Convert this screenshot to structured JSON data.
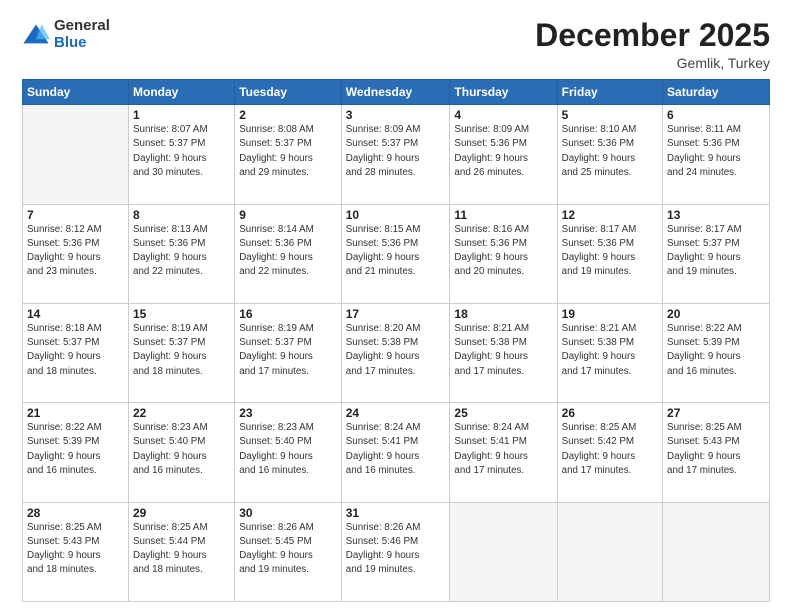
{
  "logo": {
    "general": "General",
    "blue": "Blue"
  },
  "title": "December 2025",
  "subtitle": "Gemlik, Turkey",
  "days_header": [
    "Sunday",
    "Monday",
    "Tuesday",
    "Wednesday",
    "Thursday",
    "Friday",
    "Saturday"
  ],
  "weeks": [
    [
      {
        "day": "",
        "info": ""
      },
      {
        "day": "1",
        "info": "Sunrise: 8:07 AM\nSunset: 5:37 PM\nDaylight: 9 hours\nand 30 minutes."
      },
      {
        "day": "2",
        "info": "Sunrise: 8:08 AM\nSunset: 5:37 PM\nDaylight: 9 hours\nand 29 minutes."
      },
      {
        "day": "3",
        "info": "Sunrise: 8:09 AM\nSunset: 5:37 PM\nDaylight: 9 hours\nand 28 minutes."
      },
      {
        "day": "4",
        "info": "Sunrise: 8:09 AM\nSunset: 5:36 PM\nDaylight: 9 hours\nand 26 minutes."
      },
      {
        "day": "5",
        "info": "Sunrise: 8:10 AM\nSunset: 5:36 PM\nDaylight: 9 hours\nand 25 minutes."
      },
      {
        "day": "6",
        "info": "Sunrise: 8:11 AM\nSunset: 5:36 PM\nDaylight: 9 hours\nand 24 minutes."
      }
    ],
    [
      {
        "day": "7",
        "info": "Sunrise: 8:12 AM\nSunset: 5:36 PM\nDaylight: 9 hours\nand 23 minutes."
      },
      {
        "day": "8",
        "info": "Sunrise: 8:13 AM\nSunset: 5:36 PM\nDaylight: 9 hours\nand 22 minutes."
      },
      {
        "day": "9",
        "info": "Sunrise: 8:14 AM\nSunset: 5:36 PM\nDaylight: 9 hours\nand 22 minutes."
      },
      {
        "day": "10",
        "info": "Sunrise: 8:15 AM\nSunset: 5:36 PM\nDaylight: 9 hours\nand 21 minutes."
      },
      {
        "day": "11",
        "info": "Sunrise: 8:16 AM\nSunset: 5:36 PM\nDaylight: 9 hours\nand 20 minutes."
      },
      {
        "day": "12",
        "info": "Sunrise: 8:17 AM\nSunset: 5:36 PM\nDaylight: 9 hours\nand 19 minutes."
      },
      {
        "day": "13",
        "info": "Sunrise: 8:17 AM\nSunset: 5:37 PM\nDaylight: 9 hours\nand 19 minutes."
      }
    ],
    [
      {
        "day": "14",
        "info": "Sunrise: 8:18 AM\nSunset: 5:37 PM\nDaylight: 9 hours\nand 18 minutes."
      },
      {
        "day": "15",
        "info": "Sunrise: 8:19 AM\nSunset: 5:37 PM\nDaylight: 9 hours\nand 18 minutes."
      },
      {
        "day": "16",
        "info": "Sunrise: 8:19 AM\nSunset: 5:37 PM\nDaylight: 9 hours\nand 17 minutes."
      },
      {
        "day": "17",
        "info": "Sunrise: 8:20 AM\nSunset: 5:38 PM\nDaylight: 9 hours\nand 17 minutes."
      },
      {
        "day": "18",
        "info": "Sunrise: 8:21 AM\nSunset: 5:38 PM\nDaylight: 9 hours\nand 17 minutes."
      },
      {
        "day": "19",
        "info": "Sunrise: 8:21 AM\nSunset: 5:38 PM\nDaylight: 9 hours\nand 17 minutes."
      },
      {
        "day": "20",
        "info": "Sunrise: 8:22 AM\nSunset: 5:39 PM\nDaylight: 9 hours\nand 16 minutes."
      }
    ],
    [
      {
        "day": "21",
        "info": "Sunrise: 8:22 AM\nSunset: 5:39 PM\nDaylight: 9 hours\nand 16 minutes."
      },
      {
        "day": "22",
        "info": "Sunrise: 8:23 AM\nSunset: 5:40 PM\nDaylight: 9 hours\nand 16 minutes."
      },
      {
        "day": "23",
        "info": "Sunrise: 8:23 AM\nSunset: 5:40 PM\nDaylight: 9 hours\nand 16 minutes."
      },
      {
        "day": "24",
        "info": "Sunrise: 8:24 AM\nSunset: 5:41 PM\nDaylight: 9 hours\nand 16 minutes."
      },
      {
        "day": "25",
        "info": "Sunrise: 8:24 AM\nSunset: 5:41 PM\nDaylight: 9 hours\nand 17 minutes."
      },
      {
        "day": "26",
        "info": "Sunrise: 8:25 AM\nSunset: 5:42 PM\nDaylight: 9 hours\nand 17 minutes."
      },
      {
        "day": "27",
        "info": "Sunrise: 8:25 AM\nSunset: 5:43 PM\nDaylight: 9 hours\nand 17 minutes."
      }
    ],
    [
      {
        "day": "28",
        "info": "Sunrise: 8:25 AM\nSunset: 5:43 PM\nDaylight: 9 hours\nand 18 minutes."
      },
      {
        "day": "29",
        "info": "Sunrise: 8:25 AM\nSunset: 5:44 PM\nDaylight: 9 hours\nand 18 minutes."
      },
      {
        "day": "30",
        "info": "Sunrise: 8:26 AM\nSunset: 5:45 PM\nDaylight: 9 hours\nand 19 minutes."
      },
      {
        "day": "31",
        "info": "Sunrise: 8:26 AM\nSunset: 5:46 PM\nDaylight: 9 hours\nand 19 minutes."
      },
      {
        "day": "",
        "info": ""
      },
      {
        "day": "",
        "info": ""
      },
      {
        "day": "",
        "info": ""
      }
    ]
  ]
}
